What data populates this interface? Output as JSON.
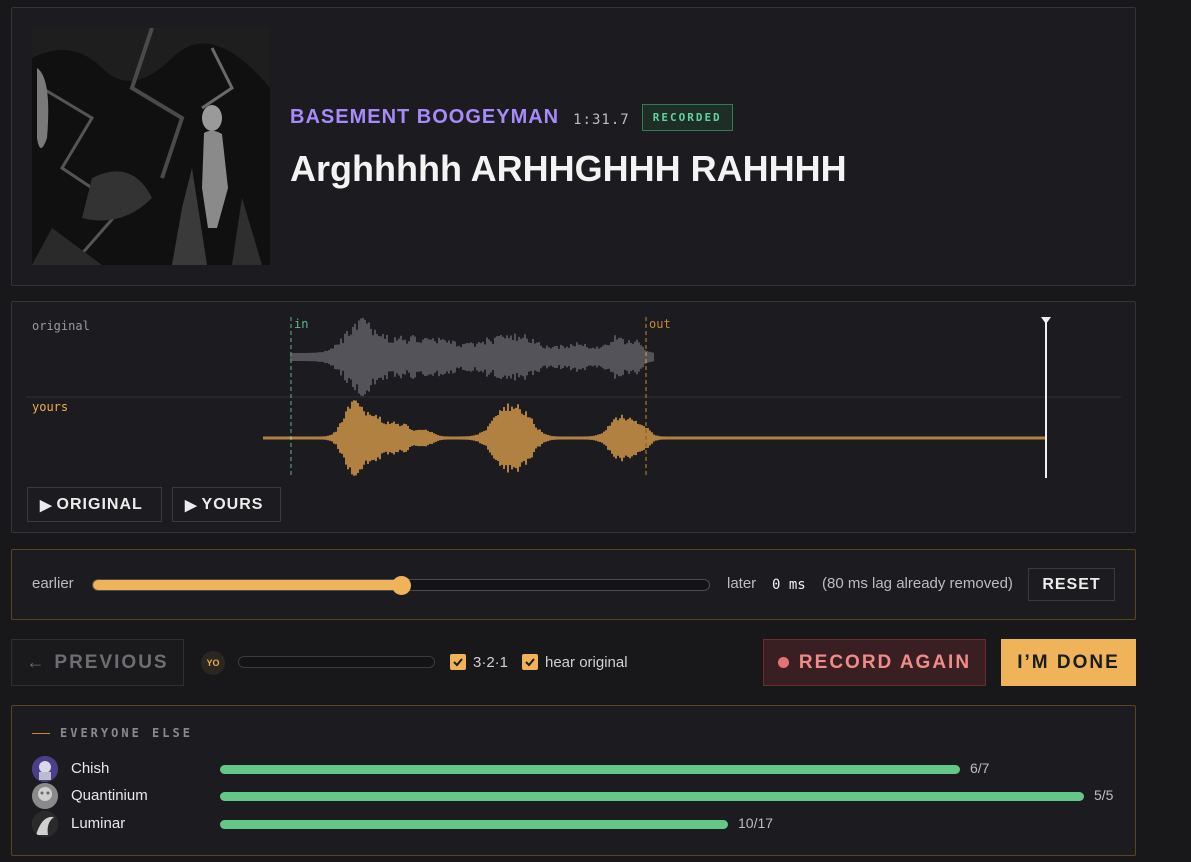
{
  "header": {
    "artist": "BASEMENT BOOGEYMAN",
    "duration": "1:31.7",
    "badge": "RECORDED",
    "title": "Arghhhhh ARHHGHHH RAHHHH"
  },
  "waveform": {
    "original_label": "original",
    "yours_label": "yours",
    "in_label": "in",
    "out_label": "out",
    "play_original_label": "ORIGINAL",
    "play_yours_label": "YOURS",
    "colors": {
      "original": "#6b6b72",
      "yours": "#f0ad4e",
      "in": "#5fb88a",
      "out": "#c48a2d"
    }
  },
  "offset": {
    "earlier_label": "earlier",
    "later_label": "later",
    "value": "0 ms",
    "slider_fraction": 0.5,
    "lag_note": "(80 ms lag already removed)",
    "reset_label": "RESET"
  },
  "controls": {
    "previous_label": "PREVIOUS",
    "avatar_initials": "YO",
    "countdown_label": "3·2·1",
    "countdown_checked": true,
    "hear_original_label": "hear original",
    "hear_original_checked": true,
    "record_again_label": "RECORD AGAIN",
    "done_label": "I’M DONE"
  },
  "others": {
    "heading": "EVERYONE ELSE",
    "rows": [
      {
        "name": "Chish",
        "score": "6/7",
        "fraction": 0.857
      },
      {
        "name": "Quantinium",
        "score": "5/5",
        "fraction": 1.0
      },
      {
        "name": "Luminar",
        "score": "10/17",
        "fraction": 0.588
      }
    ]
  },
  "colors": {
    "accent": "#efb45a",
    "artist": "#a78bfa",
    "success": "#63c788",
    "danger": "#e57373"
  }
}
